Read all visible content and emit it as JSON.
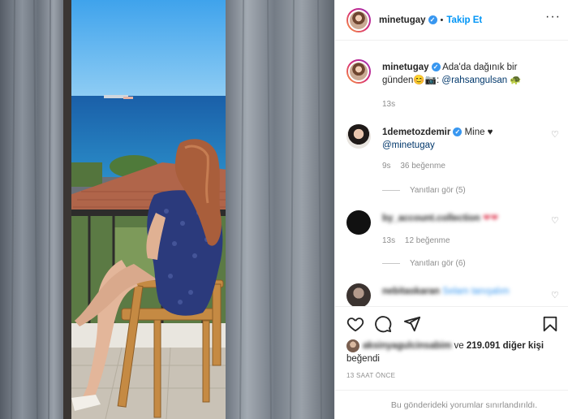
{
  "post": {
    "author": "minetugay",
    "follow_label": "Takip Et",
    "dot": "•",
    "more_icon": "more-horizontal-icon",
    "caption_text": "Ada'da dağınık bir günden😊📷: ",
    "caption_mention": "@rahsangulsan",
    "caption_emoji": "🐢",
    "caption_time": "13s"
  },
  "comments": [
    {
      "username": "1demetozdemir",
      "verified": true,
      "text": "Mine ♥",
      "mention": "@minetugay",
      "time": "9s",
      "likes": "36 beğenme",
      "replies": "Yanıtları gör (5)"
    },
    {
      "username": "by_account.collection",
      "blurred": true,
      "text": "❤❤",
      "time": "13s",
      "likes": "12 beğenme",
      "replies": "Yanıtları gör (6)"
    },
    {
      "username": "nebitaskaran",
      "blurred": true,
      "text": "Selam tanışalım"
    }
  ],
  "actions": {
    "like_icon": "heart-icon",
    "comment_icon": "comment-icon",
    "share_icon": "send-icon",
    "save_icon": "bookmark-icon"
  },
  "likes": {
    "blurred_user": "aksinyagulcinsabim",
    "connector": " ve ",
    "count_text": "219.091 diğer kişi",
    "suffix": "beğendi"
  },
  "timestamp": "13 SAAT ÖNCE",
  "comments_limited": "Bu gönderideki yorumlar sınırlandırıldı.",
  "colors": {
    "accent": "#0095f6",
    "verified": "#3897f0",
    "meta": "#8e8e8e",
    "mention": "#00376b"
  }
}
